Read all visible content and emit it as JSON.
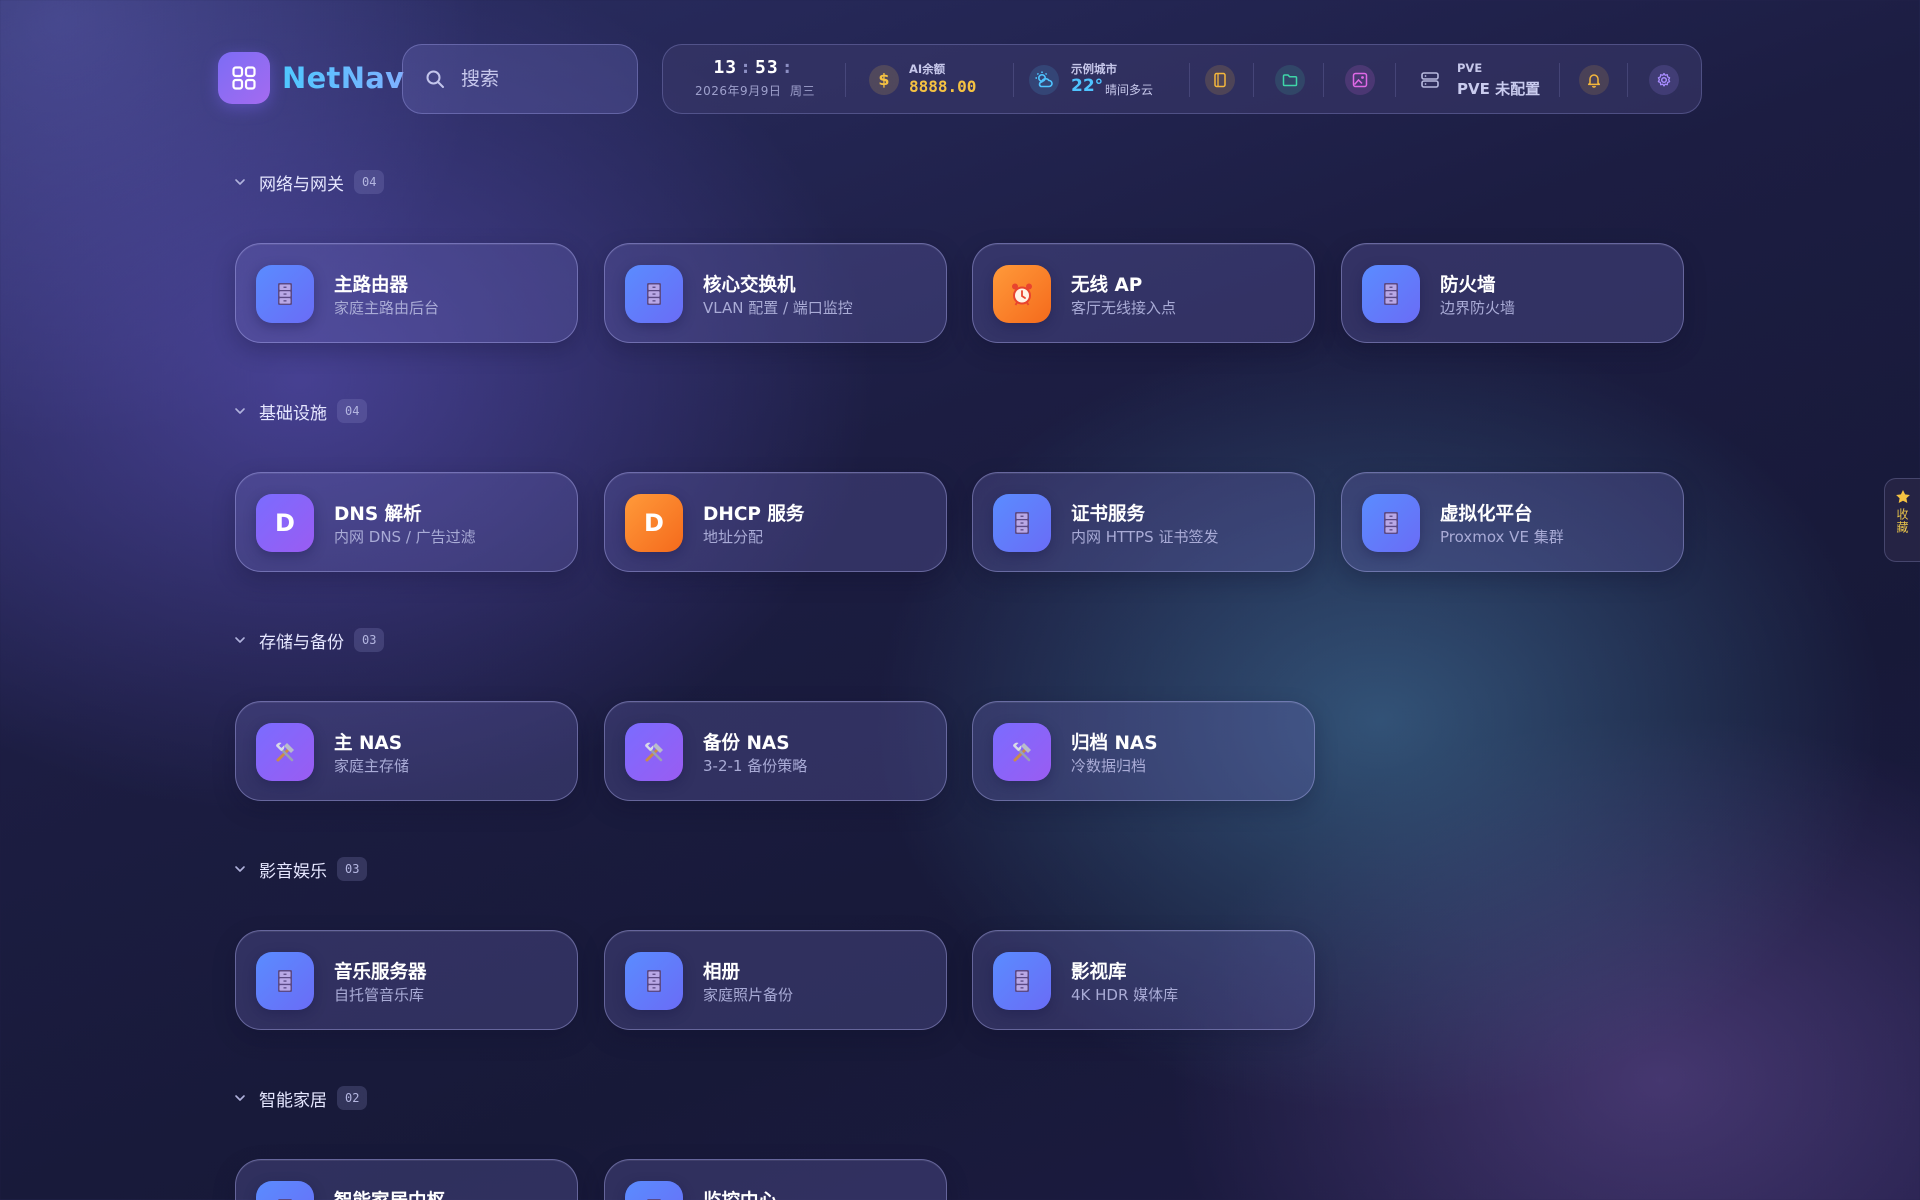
{
  "app": {
    "name": "NetNav"
  },
  "search": {
    "placeholder": "搜索",
    "value": ""
  },
  "status": {
    "clock": {
      "hour": "13",
      "minute": "53",
      "date": "2026年9月9日",
      "weekday": "周三"
    },
    "ai_balance": {
      "label": "AI余额",
      "value": "8888.00",
      "icon": "dollar-icon",
      "color": "#f5c242"
    },
    "weather": {
      "city": "示例城市",
      "temp": "22°",
      "condition": "晴间多云",
      "icon": "weather-icon",
      "color": "#4fc3ff"
    },
    "tools": [
      {
        "name": "notes-icon",
        "color": "#f5b73b"
      },
      {
        "name": "folder-icon",
        "color": "#3fd6a8"
      },
      {
        "name": "image-icon",
        "color": "#e069e6"
      }
    ],
    "pve": {
      "label": "PVE",
      "value": "PVE 未配置",
      "icon": "server-icon"
    },
    "notification": {
      "icon": "bell-icon",
      "color": "#f5b73b"
    },
    "settings": {
      "icon": "gear-icon",
      "color": "#a88cff"
    }
  },
  "sections": [
    {
      "title": "网络与网关",
      "count": "04",
      "cards": [
        {
          "title": "主路由器",
          "subtitle": "家庭主路由后台",
          "icon": "cabinet-icon",
          "color": "blue"
        },
        {
          "title": "核心交换机",
          "subtitle": "VLAN 配置 / 端口监控",
          "icon": "cabinet-icon",
          "color": "blue"
        },
        {
          "title": "无线 AP",
          "subtitle": "客厅无线接入点",
          "icon": "alarm-clock-icon",
          "color": "orange"
        },
        {
          "title": "防火墙",
          "subtitle": "边界防火墙",
          "icon": "cabinet-icon",
          "color": "blue"
        }
      ]
    },
    {
      "title": "基础设施",
      "count": "04",
      "cards": [
        {
          "title": "DNS 解析",
          "subtitle": "内网 DNS / 广告过滤",
          "icon": "letter-d-icon",
          "letter": "D",
          "color": "purple"
        },
        {
          "title": "DHCP 服务",
          "subtitle": "地址分配",
          "icon": "letter-d-icon",
          "letter": "D",
          "color": "orange"
        },
        {
          "title": "证书服务",
          "subtitle": "内网 HTTPS 证书签发",
          "icon": "cabinet-icon",
          "color": "blue"
        },
        {
          "title": "虚拟化平台",
          "subtitle": "Proxmox VE 集群",
          "icon": "cabinet-icon",
          "color": "blue"
        }
      ]
    },
    {
      "title": "存储与备份",
      "count": "03",
      "cards": [
        {
          "title": "主 NAS",
          "subtitle": "家庭主存储",
          "icon": "tools-icon",
          "color": "purple"
        },
        {
          "title": "备份 NAS",
          "subtitle": "3-2-1 备份策略",
          "icon": "tools-icon",
          "color": "purple"
        },
        {
          "title": "归档 NAS",
          "subtitle": "冷数据归档",
          "icon": "tools-icon",
          "color": "purple"
        }
      ]
    },
    {
      "title": "影音娱乐",
      "count": "03",
      "cards": [
        {
          "title": "音乐服务器",
          "subtitle": "自托管音乐库",
          "icon": "cabinet-icon",
          "color": "blue"
        },
        {
          "title": "相册",
          "subtitle": "家庭照片备份",
          "icon": "cabinet-icon",
          "color": "blue"
        },
        {
          "title": "影视库",
          "subtitle": "4K HDR 媒体库",
          "icon": "cabinet-icon",
          "color": "blue"
        }
      ]
    },
    {
      "title": "智能家居",
      "count": "02",
      "cards": [
        {
          "title": "智能家居中枢",
          "subtitle": "",
          "icon": "cabinet-icon",
          "color": "blue"
        },
        {
          "title": "监控中心",
          "subtitle": "",
          "icon": "cabinet-icon",
          "color": "blue"
        }
      ]
    }
  ],
  "favorites": {
    "label": "收藏",
    "icon": "star-icon",
    "color": "#f5c242"
  }
}
